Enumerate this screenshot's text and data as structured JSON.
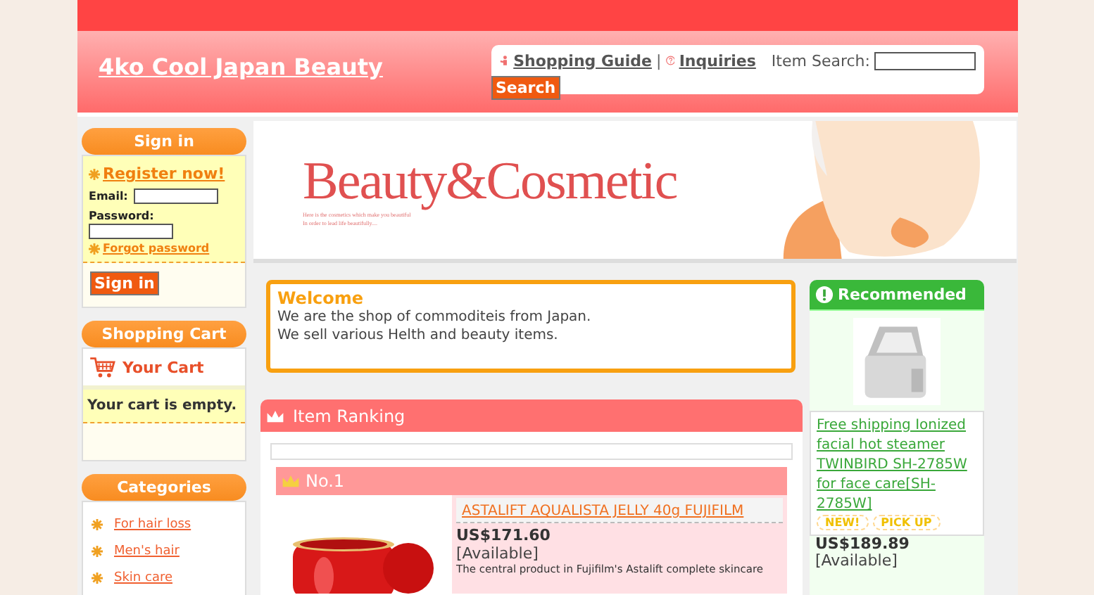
{
  "site_title": "4ko Cool Japan Beauty",
  "header_links": [
    {
      "label": "Shopping Guide",
      "kind": "guide"
    },
    {
      "label": "Inquiries",
      "kind": "help"
    }
  ],
  "header_separator": "|",
  "search": {
    "label": "Item Search:",
    "button": "Search"
  },
  "sign_in": {
    "title": "Sign in",
    "register": "Register now!",
    "email_label": "Email:",
    "password_label": "Password:",
    "forgot": "Forgot password",
    "button": "Sign in"
  },
  "cart": {
    "title": "Shopping Cart",
    "link": "Your Cart",
    "message": "Your cart is empty."
  },
  "categories": {
    "title": "Categories",
    "items": [
      "For hair loss",
      "Men's hair",
      "Skin care"
    ]
  },
  "banner": {
    "title": "Beauty&Cosmetic",
    "tagline": [
      "Here is the cosmetics which make you beautiful",
      "In order to lead life beautifully...."
    ]
  },
  "welcome": {
    "title": "Welcome",
    "lines": [
      "We are the shop of commoditeis from Japan.",
      "We sell various Helth and beauty items."
    ]
  },
  "ranking": {
    "title": "Item Ranking",
    "items": [
      {
        "rank": "No.1",
        "name": "ASTALIFT AQUALISTA JELLY 40g FUJIFILM",
        "price": "US$171.60",
        "availability": "[Available]",
        "description": "The central product in Fujifilm's Astalift complete skincare"
      }
    ]
  },
  "recommended": {
    "title": "Recommended",
    "items": [
      {
        "name": "Free shipping Ionized facial hot steamer TWINBIRD SH-2785W for face care[SH-2785W]",
        "badges": [
          "NEW!",
          "PICK UP"
        ],
        "price": "US$189.89",
        "availability": "[Available]"
      }
    ]
  }
}
